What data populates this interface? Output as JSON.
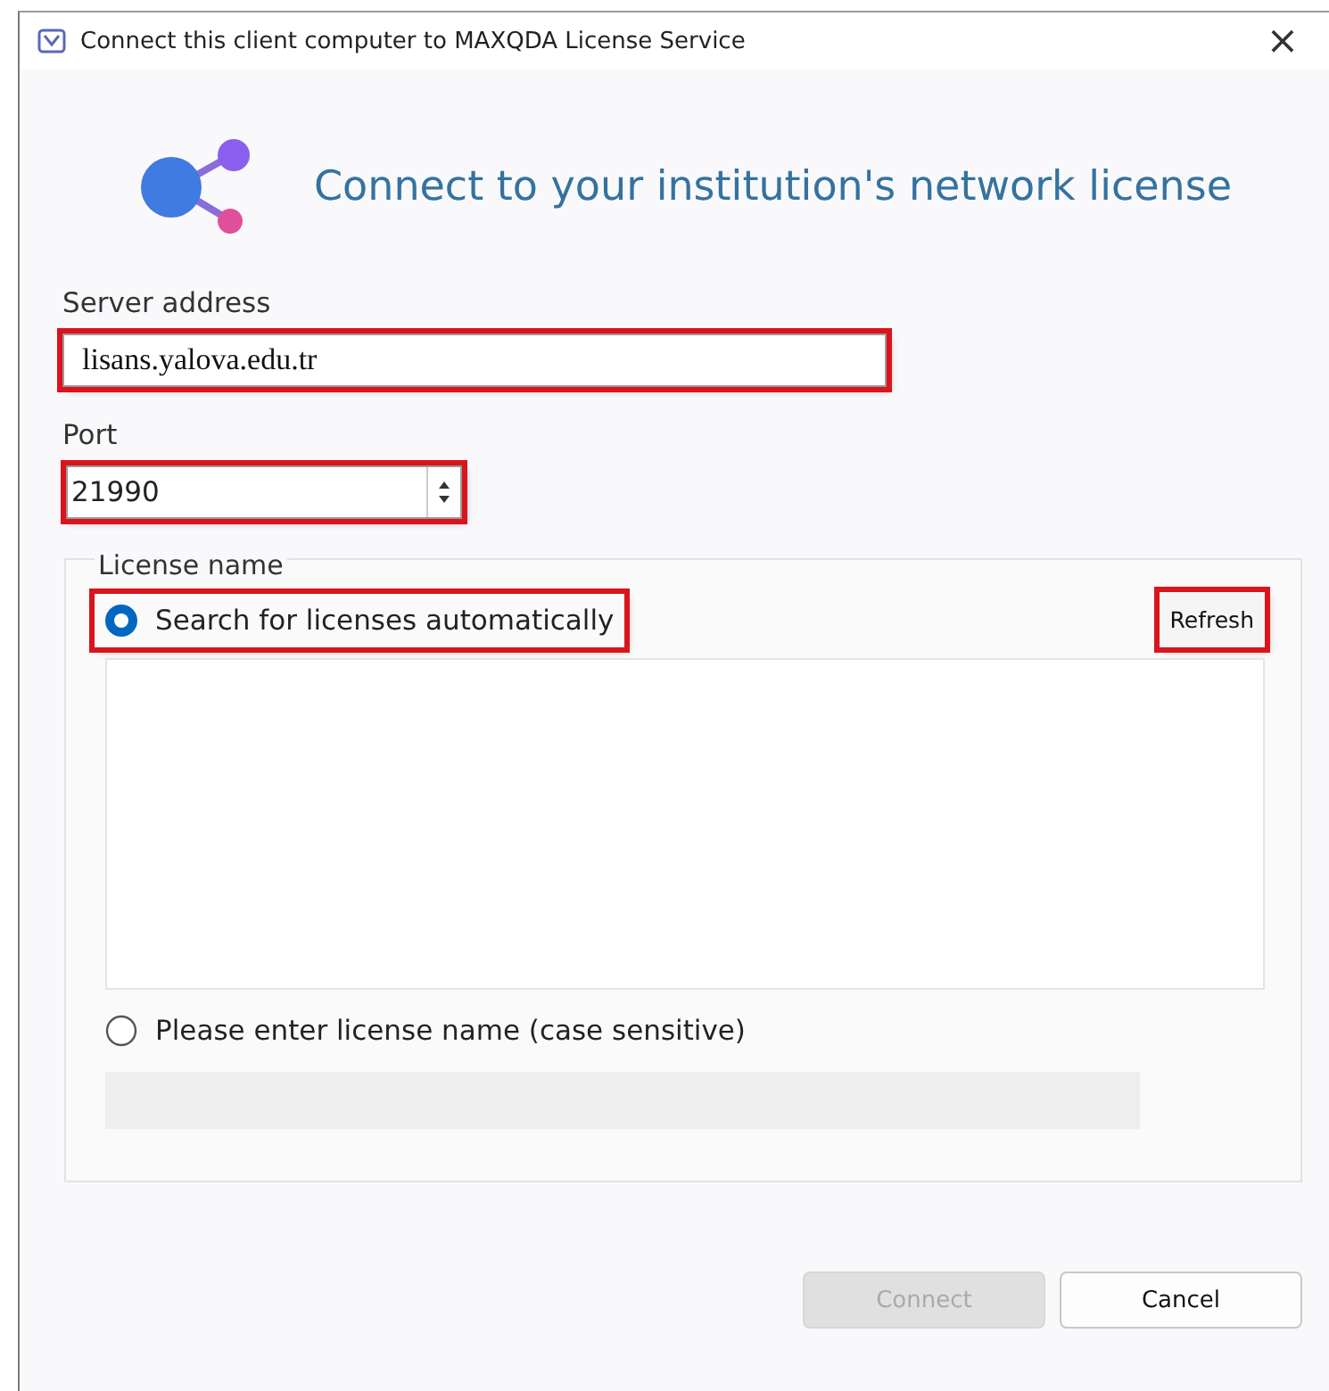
{
  "window": {
    "title": "Connect this client computer to MAXQDA License Service",
    "close": "×"
  },
  "heading": "Connect to your institution's network license",
  "server": {
    "label": "Server address",
    "value": "lisans.yalova.edu.tr",
    "highlighted": true
  },
  "port": {
    "label": "Port",
    "value": "21990",
    "highlighted": true
  },
  "license": {
    "legend": "License name",
    "options": [
      {
        "label": "Search for licenses automatically",
        "selected": true,
        "highlighted": true
      },
      {
        "label": "Please enter license name (case sensitive)",
        "selected": false,
        "highlighted": false
      }
    ],
    "refresh": {
      "label": "Refresh",
      "highlighted": true
    },
    "name_field": {
      "disabled": true
    }
  },
  "buttons": [
    {
      "label": "Connect",
      "disabled": true
    },
    {
      "label": "Cancel",
      "disabled": false
    }
  ]
}
